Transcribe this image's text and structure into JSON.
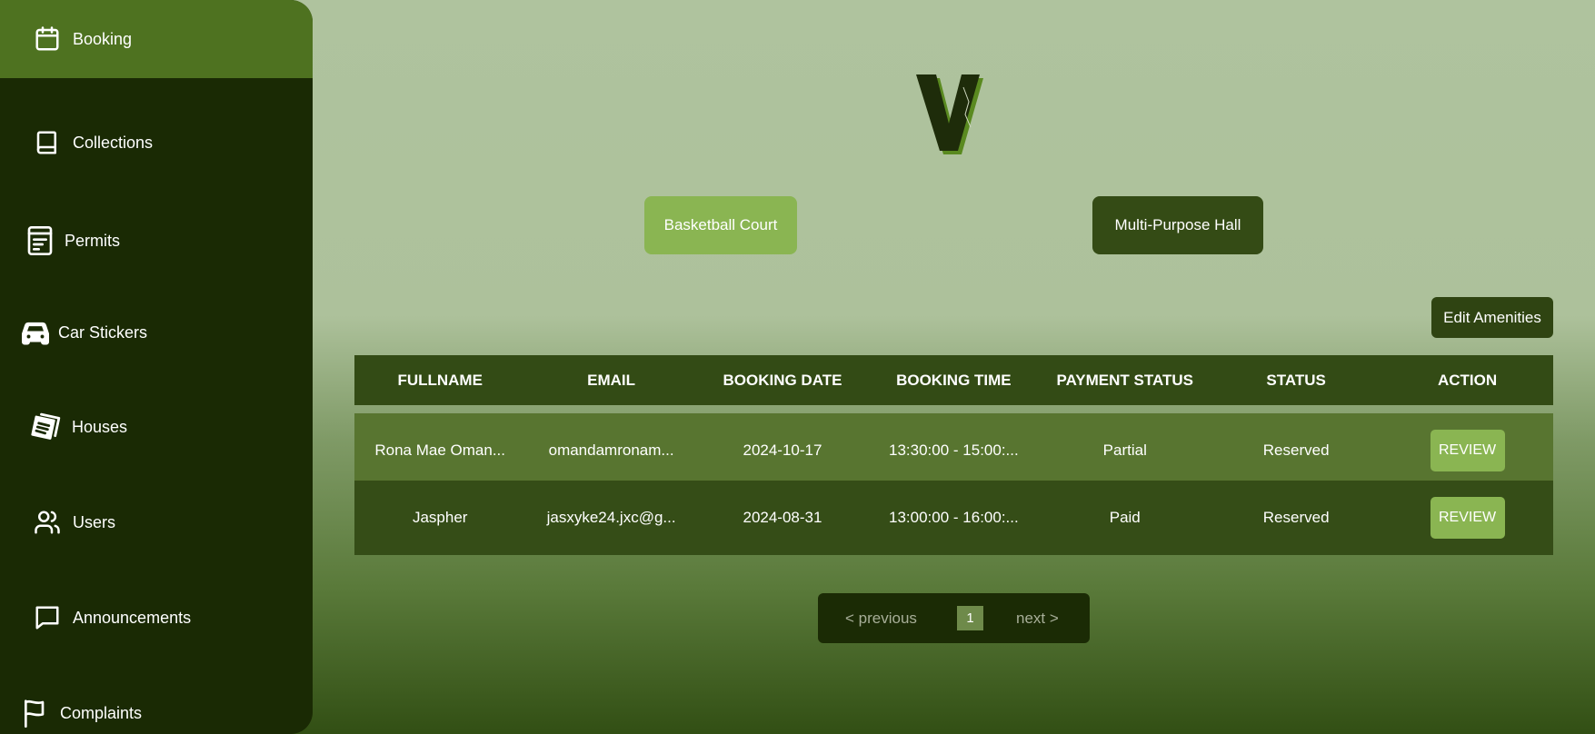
{
  "sidebar": {
    "items": [
      {
        "label": "Booking",
        "icon": "calendar-icon"
      },
      {
        "label": "Collections",
        "icon": "book-icon"
      },
      {
        "label": "Permits",
        "icon": "document-icon"
      },
      {
        "label": "Car Stickers",
        "icon": "car-icon"
      },
      {
        "label": "Houses",
        "icon": "newspaper-icon"
      },
      {
        "label": "Users",
        "icon": "users-icon"
      },
      {
        "label": "Announcements",
        "icon": "message-icon"
      },
      {
        "label": "Complaints",
        "icon": "flag-icon"
      }
    ],
    "active": "Booking"
  },
  "amenities": {
    "basketball": "Basketball Court",
    "hall": "Multi-Purpose Hall"
  },
  "edit_amenities": "Edit Amenities",
  "table": {
    "headers": [
      "FULLNAME",
      "EMAIL",
      "BOOKING DATE",
      "BOOKING TIME",
      "PAYMENT STATUS",
      "STATUS",
      "ACTION"
    ],
    "rows": [
      {
        "fullname": "Rona Mae Oman...",
        "email": "omandamronam...",
        "date": "2024-10-17",
        "time": "13:30:00 - 15:00:...",
        "payment": "Partial",
        "status": "Reserved",
        "action": "REVIEW"
      },
      {
        "fullname": "Jaspher",
        "email": "jasxyke24.jxc@g...",
        "date": "2024-08-31",
        "time": "13:00:00 - 16:00:...",
        "payment": "Paid",
        "status": "Reserved",
        "action": "REVIEW"
      }
    ]
  },
  "pagination": {
    "previous": "< previous",
    "page": "1",
    "next": "next >"
  },
  "colors": {
    "sidebar_bg": "#1a2a04",
    "active_item": "#4e7220",
    "accent": "#8ab552",
    "dark_green": "#344b15"
  }
}
